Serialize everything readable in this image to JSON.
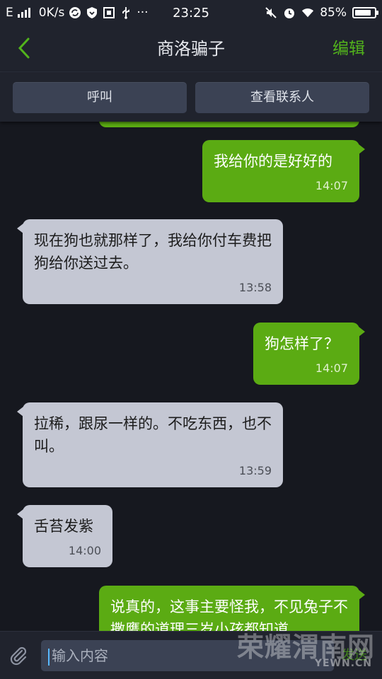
{
  "status_bar": {
    "network": "E",
    "speed": "0K/s",
    "time": "23:25",
    "battery_percent": "85%",
    "battery_level": 0.85,
    "icons": [
      "signal-icon",
      "sync-icon",
      "vpn-shield-icon",
      "screenshot-icon",
      "usb-icon",
      "more-dots-icon",
      "mute-icon",
      "alarm-icon",
      "wifi-icon",
      "battery-icon"
    ]
  },
  "nav": {
    "back_icon": "chevron-left-icon",
    "title": "商洛骗子",
    "edit_label": "编辑"
  },
  "actions": {
    "call_label": "呼叫",
    "view_contact_label": "查看联系人"
  },
  "messages": [
    {
      "direction": "out",
      "text": "我给你的是好好的",
      "time": "14:07"
    },
    {
      "direction": "in",
      "text": "现在狗也就那样了，我给你付车费把狗给你送过去。",
      "time": "13:58"
    },
    {
      "direction": "out",
      "text": "狗怎样了？",
      "time": "14:07"
    },
    {
      "direction": "in",
      "text": "拉稀，跟尿一样的。不吃东西，也不叫。",
      "time": "13:59"
    },
    {
      "direction": "in",
      "text": "舌苔发紫",
      "time": "14:00"
    },
    {
      "direction": "out",
      "text": "说真的，这事主要怪我，不见兔子不撒鹰的道理三岁小孩都知道",
      "time": ""
    }
  ],
  "input": {
    "placeholder": "输入内容",
    "attach_icon": "paperclip-icon",
    "send_label": "发送"
  },
  "watermark": {
    "logo": "荣耀渭南网",
    "url": "YEWN.CN"
  },
  "colors": {
    "accent_green": "#52b31c",
    "outgoing_bubble": "#5bab13",
    "incoming_bubble": "#c4c7d3",
    "background": "#16181f",
    "bar": "#20232d"
  }
}
